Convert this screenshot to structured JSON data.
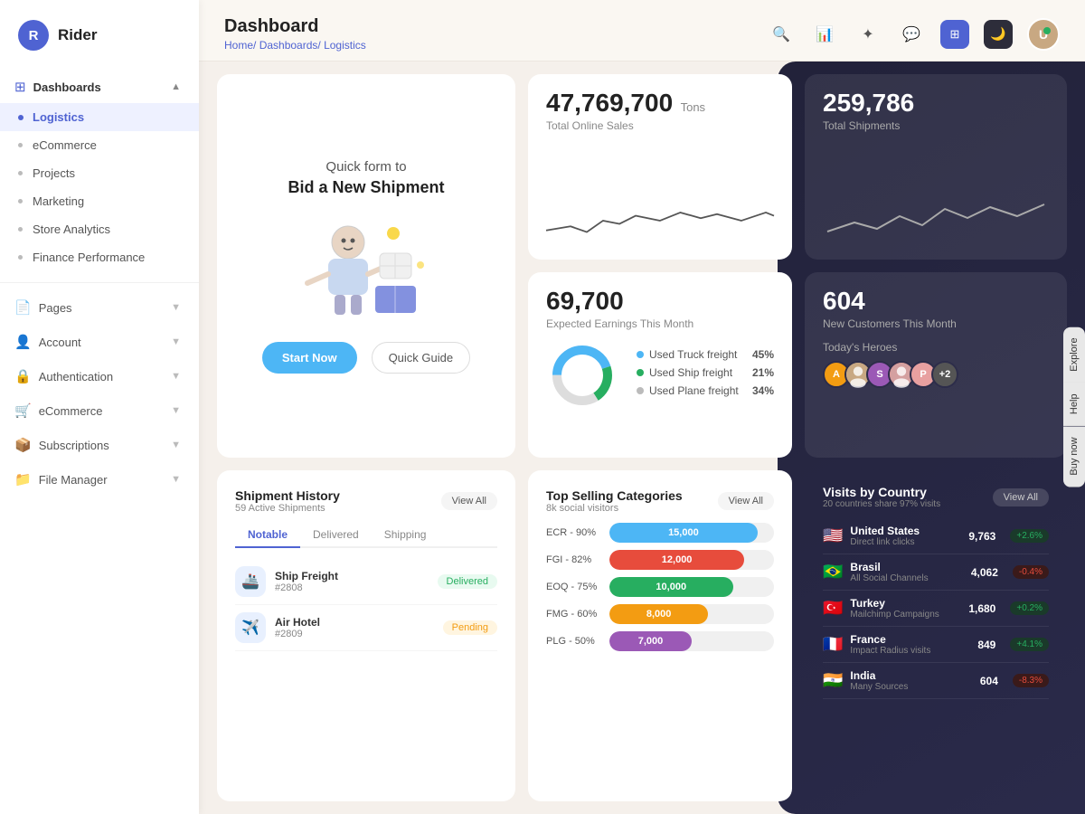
{
  "app": {
    "logo_letter": "R",
    "logo_name": "Rider"
  },
  "sidebar": {
    "dashboards_label": "Dashboards",
    "items": [
      {
        "id": "logistics",
        "label": "Logistics",
        "active": true
      },
      {
        "id": "ecommerce",
        "label": "eCommerce",
        "active": false
      },
      {
        "id": "projects",
        "label": "Projects",
        "active": false
      },
      {
        "id": "marketing",
        "label": "Marketing",
        "active": false
      },
      {
        "id": "store-analytics",
        "label": "Store Analytics",
        "active": false
      },
      {
        "id": "finance",
        "label": "Finance Performance",
        "active": false
      }
    ],
    "pages_label": "Pages",
    "account_label": "Account",
    "authentication_label": "Authentication",
    "ecommerce_label": "eCommerce",
    "subscriptions_label": "Subscriptions",
    "file_manager_label": "File Manager"
  },
  "header": {
    "page_title": "Dashboard",
    "breadcrumb": [
      "Home",
      "Dashboards",
      "Logistics"
    ]
  },
  "quick_form": {
    "subtitle": "Quick form to",
    "title": "Bid a New Shipment",
    "btn_start": "Start Now",
    "btn_guide": "Quick Guide"
  },
  "stats": {
    "total_sales_number": "47,769,700",
    "total_sales_unit": "Tons",
    "total_sales_label": "Total Online Sales",
    "total_shipments_number": "259,786",
    "total_shipments_label": "Total Shipments",
    "earnings_number": "69,700",
    "earnings_label": "Expected Earnings This Month",
    "customers_number": "604",
    "customers_label": "New Customers This Month"
  },
  "freight": {
    "truck_label": "Used Truck freight",
    "truck_pct": "45%",
    "ship_label": "Used Ship freight",
    "ship_pct": "21%",
    "plane_label": "Used Plane freight",
    "plane_pct": "34%"
  },
  "heroes": {
    "label": "Today's Heroes",
    "avatars": [
      {
        "letter": "A",
        "color": "#f39c12"
      },
      {
        "letter": "S",
        "color": "#9b59b6"
      },
      {
        "letter": "P",
        "color": "#e74c3c"
      },
      {
        "letter": "+2",
        "color": "#555"
      }
    ]
  },
  "shipment_history": {
    "title": "Shipment History",
    "subtitle": "59 Active Shipments",
    "view_all": "View All",
    "tabs": [
      "Notable",
      "Delivered",
      "Shipping"
    ],
    "active_tab": "Notable",
    "items": [
      {
        "name": "Ship Freight",
        "id": "#2808",
        "status": "Delivered",
        "icon": "🚢"
      },
      {
        "name": "Air Hotel",
        "id": "#2809",
        "status": "Pending",
        "icon": "✈️"
      }
    ]
  },
  "top_selling": {
    "title": "Top Selling Categories",
    "subtitle": "8k social visitors",
    "view_all": "View All",
    "bars": [
      {
        "label": "ECR - 90%",
        "value": 15000,
        "display": "15,000",
        "color": "#4db6f5",
        "width": "90%"
      },
      {
        "label": "FGI - 82%",
        "value": 12000,
        "display": "12,000",
        "color": "#e74c3c",
        "width": "82%"
      },
      {
        "label": "EOQ - 75%",
        "value": 10000,
        "display": "10,000",
        "color": "#27ae60",
        "width": "75%"
      },
      {
        "label": "FMG - 60%",
        "value": 8000,
        "display": "8,000",
        "color": "#f39c12",
        "width": "60%"
      },
      {
        "label": "PLG - 50%",
        "value": 7000,
        "display": "7,000",
        "color": "#9b59b6",
        "width": "50%"
      }
    ]
  },
  "visits_by_country": {
    "title": "Visits by Country",
    "subtitle": "20 countries share 97% visits",
    "view_all": "View All",
    "countries": [
      {
        "flag": "🇺🇸",
        "name": "United States",
        "sub": "Direct link clicks",
        "visits": "9,763",
        "change": "+2.6%",
        "up": true
      },
      {
        "flag": "🇧🇷",
        "name": "Brasil",
        "sub": "All Social Channels",
        "visits": "4,062",
        "change": "-0.4%",
        "up": false
      },
      {
        "flag": "🇹🇷",
        "name": "Turkey",
        "sub": "Mailchimp Campaigns",
        "visits": "1,680",
        "change": "+0.2%",
        "up": true
      },
      {
        "flag": "🇫🇷",
        "name": "France",
        "sub": "Impact Radius visits",
        "visits": "849",
        "change": "+4.1%",
        "up": true
      },
      {
        "flag": "🇮🇳",
        "name": "India",
        "sub": "Many Sources",
        "visits": "604",
        "change": "-8.3%",
        "up": false
      }
    ]
  },
  "side_tabs": [
    "Explore",
    "Help",
    "Buy now"
  ]
}
